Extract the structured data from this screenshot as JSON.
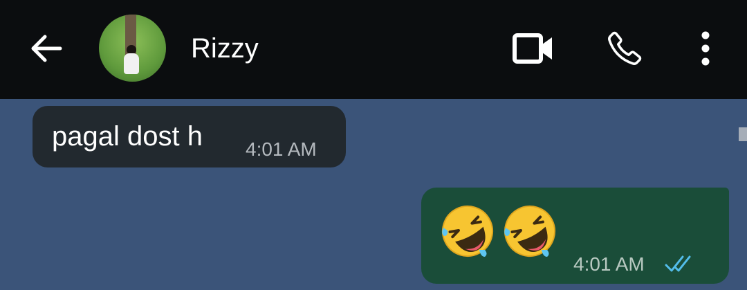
{
  "header": {
    "contact_name": "Rizzy",
    "icons": {
      "back": "arrow-left-icon",
      "video": "video-camera-icon",
      "call": "phone-icon",
      "menu": "more-vertical-icon"
    }
  },
  "messages": [
    {
      "direction": "incoming",
      "text": "pagal dost h",
      "time": "4:01 AM"
    },
    {
      "direction": "outgoing",
      "emojis": [
        "🤣",
        "🤣"
      ],
      "time": "4:01 AM",
      "status": "read"
    }
  ],
  "colors": {
    "chat_background": "#3b5479",
    "header_background": "#0b0d0f",
    "incoming_bubble": "#22292f",
    "outgoing_bubble": "#1a4d39",
    "read_ticks": "#53bdeb"
  }
}
